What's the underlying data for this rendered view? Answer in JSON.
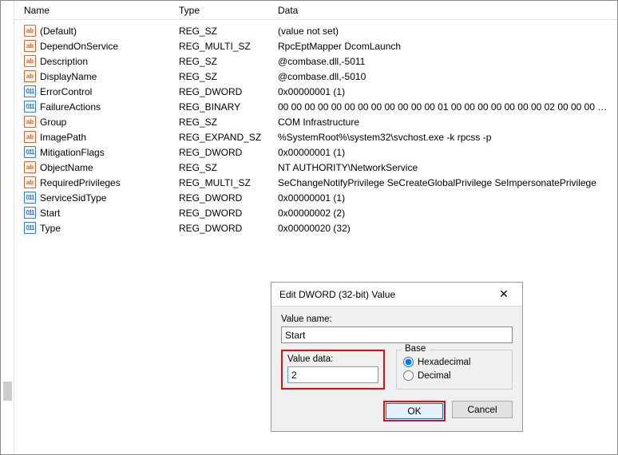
{
  "columns": {
    "name": "Name",
    "type": "Type",
    "data": "Data"
  },
  "rows": [
    {
      "icon": "string",
      "name": "(Default)",
      "type": "REG_SZ",
      "data": "(value not set)"
    },
    {
      "icon": "string",
      "name": "DependOnService",
      "type": "REG_MULTI_SZ",
      "data": "RpcEptMapper DcomLaunch"
    },
    {
      "icon": "string",
      "name": "Description",
      "type": "REG_SZ",
      "data": "@combase.dll,-5011"
    },
    {
      "icon": "string",
      "name": "DisplayName",
      "type": "REG_SZ",
      "data": "@combase.dll,-5010"
    },
    {
      "icon": "binary",
      "name": "ErrorControl",
      "type": "REG_DWORD",
      "data": "0x00000001 (1)"
    },
    {
      "icon": "binary",
      "name": "FailureActions",
      "type": "REG_BINARY",
      "data": "00 00 00 00 00 00 00 00 00 00 00 00 01 00 00 00 00 00 00 00 02 00 00 00 60 ea 0..."
    },
    {
      "icon": "string",
      "name": "Group",
      "type": "REG_SZ",
      "data": "COM Infrastructure"
    },
    {
      "icon": "string",
      "name": "ImagePath",
      "type": "REG_EXPAND_SZ",
      "data": "%SystemRoot%\\system32\\svchost.exe -k rpcss -p"
    },
    {
      "icon": "binary",
      "name": "MitigationFlags",
      "type": "REG_DWORD",
      "data": "0x00000001 (1)"
    },
    {
      "icon": "string",
      "name": "ObjectName",
      "type": "REG_SZ",
      "data": "NT AUTHORITY\\NetworkService"
    },
    {
      "icon": "string",
      "name": "RequiredPrivileges",
      "type": "REG_MULTI_SZ",
      "data": "SeChangeNotifyPrivilege SeCreateGlobalPrivilege SeImpersonatePrivilege"
    },
    {
      "icon": "binary",
      "name": "ServiceSidType",
      "type": "REG_DWORD",
      "data": "0x00000001 (1)"
    },
    {
      "icon": "binary",
      "name": "Start",
      "type": "REG_DWORD",
      "data": "0x00000002 (2)"
    },
    {
      "icon": "binary",
      "name": "Type",
      "type": "REG_DWORD",
      "data": "0x00000020 (32)"
    }
  ],
  "dialog": {
    "title": "Edit DWORD (32-bit) Value",
    "value_name_label": "Value name:",
    "value_name": "Start",
    "value_data_label": "Value data:",
    "value_data": "2",
    "base_label": "Base",
    "hex_label": "Hexadecimal",
    "dec_label": "Decimal",
    "ok": "OK",
    "cancel": "Cancel"
  }
}
